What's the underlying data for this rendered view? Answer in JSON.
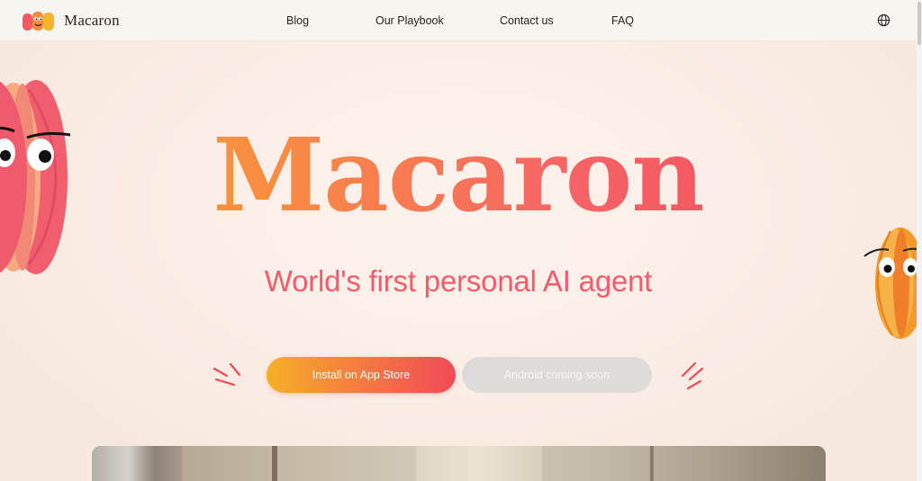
{
  "header": {
    "brand": "Macaron",
    "nav": [
      {
        "label": "Blog"
      },
      {
        "label": "Our Playbook"
      },
      {
        "label": "Contact us"
      },
      {
        "label": "FAQ"
      }
    ],
    "language_icon": "globe-icon"
  },
  "hero": {
    "title": "Macaron",
    "subtitle": "World's first personal AI agent",
    "buttons": {
      "app_store": "Install on App Store",
      "android": "Android coming soon"
    }
  },
  "colors": {
    "accent_orange": "#f7a62b",
    "accent_red": "#f1465a",
    "subtitle": "#f45b6c",
    "disabled_button": "#dedbd8"
  }
}
